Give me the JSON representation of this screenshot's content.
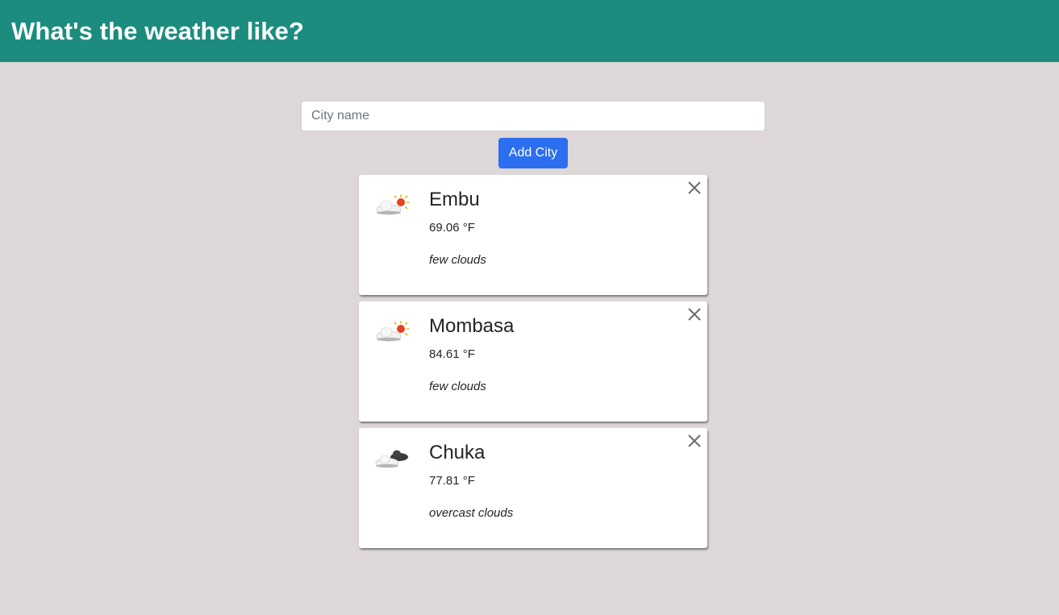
{
  "header": {
    "title": "What's the weather like?"
  },
  "search": {
    "placeholder": "City name",
    "value": "",
    "add_label": "Add City"
  },
  "cities": [
    {
      "name": "Embu",
      "temperature": "69.06 °F",
      "description": "few clouds",
      "icon": "few-clouds-day-icon"
    },
    {
      "name": "Mombasa",
      "temperature": "84.61 °F",
      "description": "few clouds",
      "icon": "few-clouds-day-icon"
    },
    {
      "name": "Chuka",
      "temperature": "77.81 °F",
      "description": "overcast clouds",
      "icon": "overcast-clouds-icon"
    }
  ],
  "colors": {
    "header_bg": "#1c8c7e",
    "page_bg": "#ddd7d7",
    "button_bg": "#2b6ff0"
  }
}
